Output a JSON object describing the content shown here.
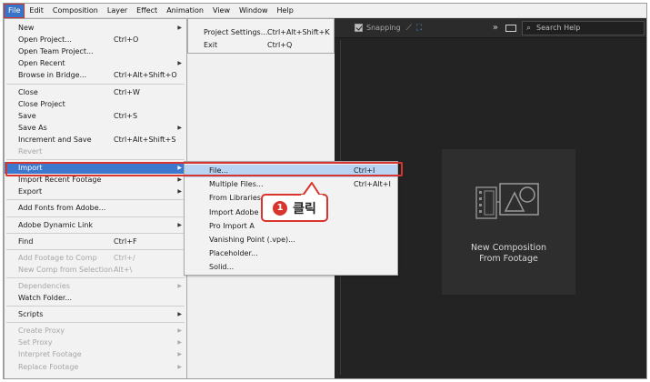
{
  "menubar": [
    "File",
    "Edit",
    "Composition",
    "Layer",
    "Effect",
    "Animation",
    "View",
    "Window",
    "Help"
  ],
  "file_menu": [
    {
      "label": "New",
      "shortcut": "",
      "arrow": true,
      "disabled": false
    },
    {
      "label": "Open Project...",
      "shortcut": "Ctrl+O",
      "arrow": false,
      "disabled": false
    },
    {
      "label": "Open Team Project...",
      "shortcut": "",
      "arrow": false,
      "disabled": false
    },
    {
      "label": "Open Recent",
      "shortcut": "",
      "arrow": true,
      "disabled": false
    },
    {
      "label": "Browse in Bridge...",
      "shortcut": "Ctrl+Alt+Shift+O",
      "arrow": false,
      "disabled": false
    },
    {
      "sep": true
    },
    {
      "label": "Close",
      "shortcut": "Ctrl+W",
      "arrow": false,
      "disabled": false
    },
    {
      "label": "Close Project",
      "shortcut": "",
      "arrow": false,
      "disabled": false
    },
    {
      "label": "Save",
      "shortcut": "Ctrl+S",
      "arrow": false,
      "disabled": false
    },
    {
      "label": "Save As",
      "shortcut": "",
      "arrow": true,
      "disabled": false
    },
    {
      "label": "Increment and Save",
      "shortcut": "Ctrl+Alt+Shift+S",
      "arrow": false,
      "disabled": false
    },
    {
      "label": "Revert",
      "shortcut": "",
      "arrow": false,
      "disabled": true
    },
    {
      "sep": true
    },
    {
      "label": "Import",
      "shortcut": "",
      "arrow": true,
      "disabled": false,
      "highlight": true
    },
    {
      "label": "Import Recent Footage",
      "shortcut": "",
      "arrow": true,
      "disabled": false
    },
    {
      "label": "Export",
      "shortcut": "",
      "arrow": true,
      "disabled": false
    },
    {
      "sep": true
    },
    {
      "label": "Add Fonts from Adobe...",
      "shortcut": "",
      "arrow": false,
      "disabled": false
    },
    {
      "sep": true
    },
    {
      "label": "Adobe Dynamic Link",
      "shortcut": "",
      "arrow": true,
      "disabled": false
    },
    {
      "sep": true
    },
    {
      "label": "Find",
      "shortcut": "Ctrl+F",
      "arrow": false,
      "disabled": false
    },
    {
      "sep": true
    },
    {
      "label": "Add Footage to Comp",
      "shortcut": "Ctrl+/",
      "arrow": false,
      "disabled": true
    },
    {
      "label": "New Comp from Selection",
      "shortcut": "Alt+\\",
      "arrow": false,
      "disabled": true
    },
    {
      "sep": true
    },
    {
      "label": "Dependencies",
      "shortcut": "",
      "arrow": true,
      "disabled": true
    },
    {
      "label": "Watch Folder...",
      "shortcut": "",
      "arrow": false,
      "disabled": false
    },
    {
      "sep": true
    },
    {
      "label": "Scripts",
      "shortcut": "",
      "arrow": true,
      "disabled": false
    },
    {
      "sep": true
    },
    {
      "label": "Create Proxy",
      "shortcut": "",
      "arrow": true,
      "disabled": true
    },
    {
      "label": "Set Proxy",
      "shortcut": "",
      "arrow": true,
      "disabled": true
    },
    {
      "label": "Interpret Footage",
      "shortcut": "",
      "arrow": true,
      "disabled": true
    },
    {
      "label": "Replace Footage",
      "shortcut": "",
      "arrow": true,
      "disabled": true
    }
  ],
  "sub_menu": [
    {
      "label": "Project Settings...",
      "shortcut": "Ctrl+Alt+Shift+K"
    },
    {
      "label": "Exit",
      "shortcut": "Ctrl+Q"
    }
  ],
  "import_menu": [
    {
      "label": "File...",
      "shortcut": "Ctrl+I",
      "highlight": true
    },
    {
      "label": "Multiple Files...",
      "shortcut": "Ctrl+Alt+I"
    },
    {
      "label": "From Libraries",
      "shortcut": ""
    },
    {
      "label": "Import Adobe",
      "shortcut": ""
    },
    {
      "label": "Pro Import A",
      "shortcut": ""
    },
    {
      "label": "Vanishing Point (.vpe)...",
      "shortcut": ""
    },
    {
      "label": "Placeholder...",
      "shortcut": ""
    },
    {
      "label": "Solid...",
      "shortcut": ""
    }
  ],
  "panel": {
    "snapping": "Snapping",
    "search": "Search Help",
    "chevron": "»"
  },
  "new_comp": {
    "line1": "New Composition",
    "line2": "From Footage"
  },
  "callout": {
    "number": "1",
    "text": "클릭"
  },
  "colors": {
    "highlight": "#3d78cf",
    "accent_red": "#d9352f",
    "workspace": "#232323"
  }
}
